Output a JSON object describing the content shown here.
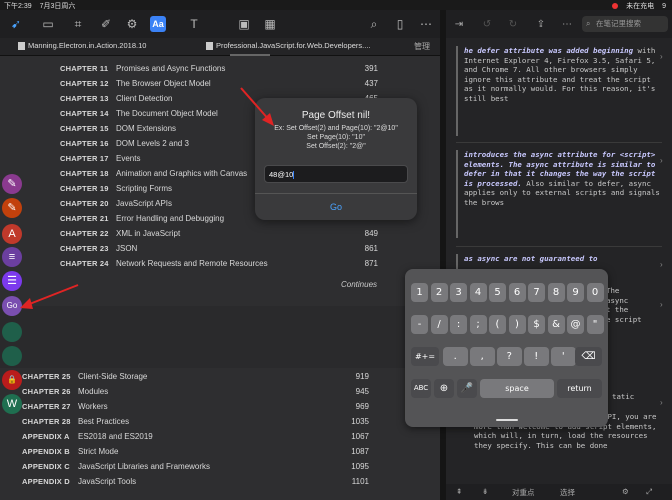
{
  "status": {
    "time": "下午2:39",
    "date": "7月3日周六",
    "battery": "未在充电",
    "battery_pct": "9"
  },
  "left_toolbar": {
    "icons": [
      "pointer-icon",
      "document-icon",
      "crop-icon",
      "brush-icon",
      "gear-icon",
      "aa-icon",
      "text-box-icon",
      "image-icon",
      "table-icon",
      "search-icon",
      "bookmark-icon",
      "more-icon"
    ],
    "aa_label": "Aa"
  },
  "tabs": {
    "tab1": "Manning.Electron.in.Action.2018.10",
    "tab2": "Professional.JavaScript.for.Web.Developers....",
    "manage": "管理"
  },
  "toc_top": [
    {
      "ch": "CHAPTER 11",
      "title": "Promises and Async Functions",
      "page": "391"
    },
    {
      "ch": "CHAPTER 12",
      "title": "The Browser Object Model",
      "page": "437"
    },
    {
      "ch": "CHAPTER 13",
      "title": "Client Detection",
      "page": "465"
    },
    {
      "ch": "CHAPTER 14",
      "title": "The Document Object Model",
      "page": ""
    },
    {
      "ch": "CHAPTER 15",
      "title": "DOM Extensions",
      "page": ""
    },
    {
      "ch": "CHAPTER 16",
      "title": "DOM Levels 2 and 3",
      "page": ""
    },
    {
      "ch": "CHAPTER 17",
      "title": "Events",
      "page": ""
    },
    {
      "ch": "CHAPTER 18",
      "title": "Animation and Graphics with Canvas",
      "page": ""
    },
    {
      "ch": "CHAPTER 19",
      "title": "Scripting Forms",
      "page": ""
    },
    {
      "ch": "CHAPTER 20",
      "title": "JavaScript APIs",
      "page": ""
    },
    {
      "ch": "CHAPTER 21",
      "title": "Error Handling and Debugging",
      "page": ""
    },
    {
      "ch": "CHAPTER 22",
      "title": "XML in JavaScript",
      "page": "849"
    },
    {
      "ch": "CHAPTER 23",
      "title": "JSON",
      "page": "861"
    },
    {
      "ch": "CHAPTER 24",
      "title": "Network Requests and Remote Resources",
      "page": "871"
    }
  ],
  "continues": "Continues",
  "toc_bottom": [
    {
      "ch": "CHAPTER 25",
      "title": "Client-Side Storage",
      "page": "919"
    },
    {
      "ch": "CHAPTER 26",
      "title": "Modules",
      "page": "945"
    },
    {
      "ch": "CHAPTER 27",
      "title": "Workers",
      "page": "969"
    },
    {
      "ch": "CHAPTER 28",
      "title": "Best Practices",
      "page": "1035"
    },
    {
      "ch": "APPENDIX A",
      "title": "ES2018 and ES2019",
      "page": "1067"
    },
    {
      "ch": "APPENDIX B",
      "title": "Strict Mode",
      "page": "1087"
    },
    {
      "ch": "APPENDIX C",
      "title": "JavaScript Libraries and Frameworks",
      "page": "1095"
    },
    {
      "ch": "APPENDIX D",
      "title": "JavaScript Tools",
      "page": "1101"
    }
  ],
  "side_buttons": [
    {
      "icon": "highlighter-icon",
      "glyph": "✎",
      "color": "#8a3a8f"
    },
    {
      "icon": "pen-icon",
      "glyph": "✎",
      "color": "#c2410c"
    },
    {
      "icon": "text-tool-icon",
      "glyph": "A",
      "color": "#c0392b"
    },
    {
      "icon": "list-icon",
      "glyph": "≡",
      "color": "#6b3fa0"
    },
    {
      "icon": "lines-icon",
      "glyph": "☰",
      "color": "#7c3aed"
    },
    {
      "icon": "go-icon",
      "glyph": "Go",
      "color": "#7a4fb0"
    },
    {
      "icon": "blank-icon",
      "glyph": "",
      "color": "#1f5f4a"
    },
    {
      "icon": "blank-icon-2",
      "glyph": "",
      "color": "#1f5f4a"
    },
    {
      "icon": "lock-icon",
      "glyph": "🔒",
      "color": "#b91c1c"
    },
    {
      "icon": "wc-icon",
      "glyph": "W",
      "color": "#1f6f50"
    }
  ],
  "dialog": {
    "title": "Page Offset nil!",
    "line1": "Ex: Set Offset(2) and Page(10): \"2@10\"",
    "line2": "Set Page(10): \"10\"",
    "line3": "Set Offset(2): \"2@\"",
    "input_value": "48@10",
    "go": "Go"
  },
  "right_pane": {
    "search_placeholder": "在笔记里搜索",
    "note1_hl": "he defer attribute was added beginning",
    "note1_rest": " with Internet Explorer 4, Firefox 3.5, Safari 5,  and Chrome 7. All other browsers simply ignore this attribute and treat the script as it normally would. For this reason, it's still best",
    "note2_hl": "introduces the async attribute for <script> elements. The async attribute is similar to defer in that it changes the way the script is processed.",
    "note2_rest": " Also similar to defer, async applies only to external scripts and signals the brows",
    "note3_hl": "as async are not guaranteed to",
    "note4_a": "The",
    "note4_b": "async",
    "note4_c": "t the",
    "note4_d": "e script",
    "note5_a": "tatic",
    "note6": "cript is able to use the DOM API, you are more than welcome to add script elements, which will, in turn, load the resources they specify. This can be done",
    "bottom_left": "对重点",
    "bottom_mid": "选择"
  },
  "keyboard": {
    "row1": [
      "1",
      "2",
      "3",
      "4",
      "5",
      "6",
      "7",
      "8",
      "9",
      "0"
    ],
    "row2": [
      "-",
      "/",
      ":",
      ";",
      "(",
      ")",
      "$",
      "&",
      "@",
      "\""
    ],
    "row3_left": "#+=",
    "row3": [
      ".",
      ",",
      "?",
      "!",
      "'"
    ],
    "abc": "ABC",
    "space": "space",
    "return": "return"
  }
}
